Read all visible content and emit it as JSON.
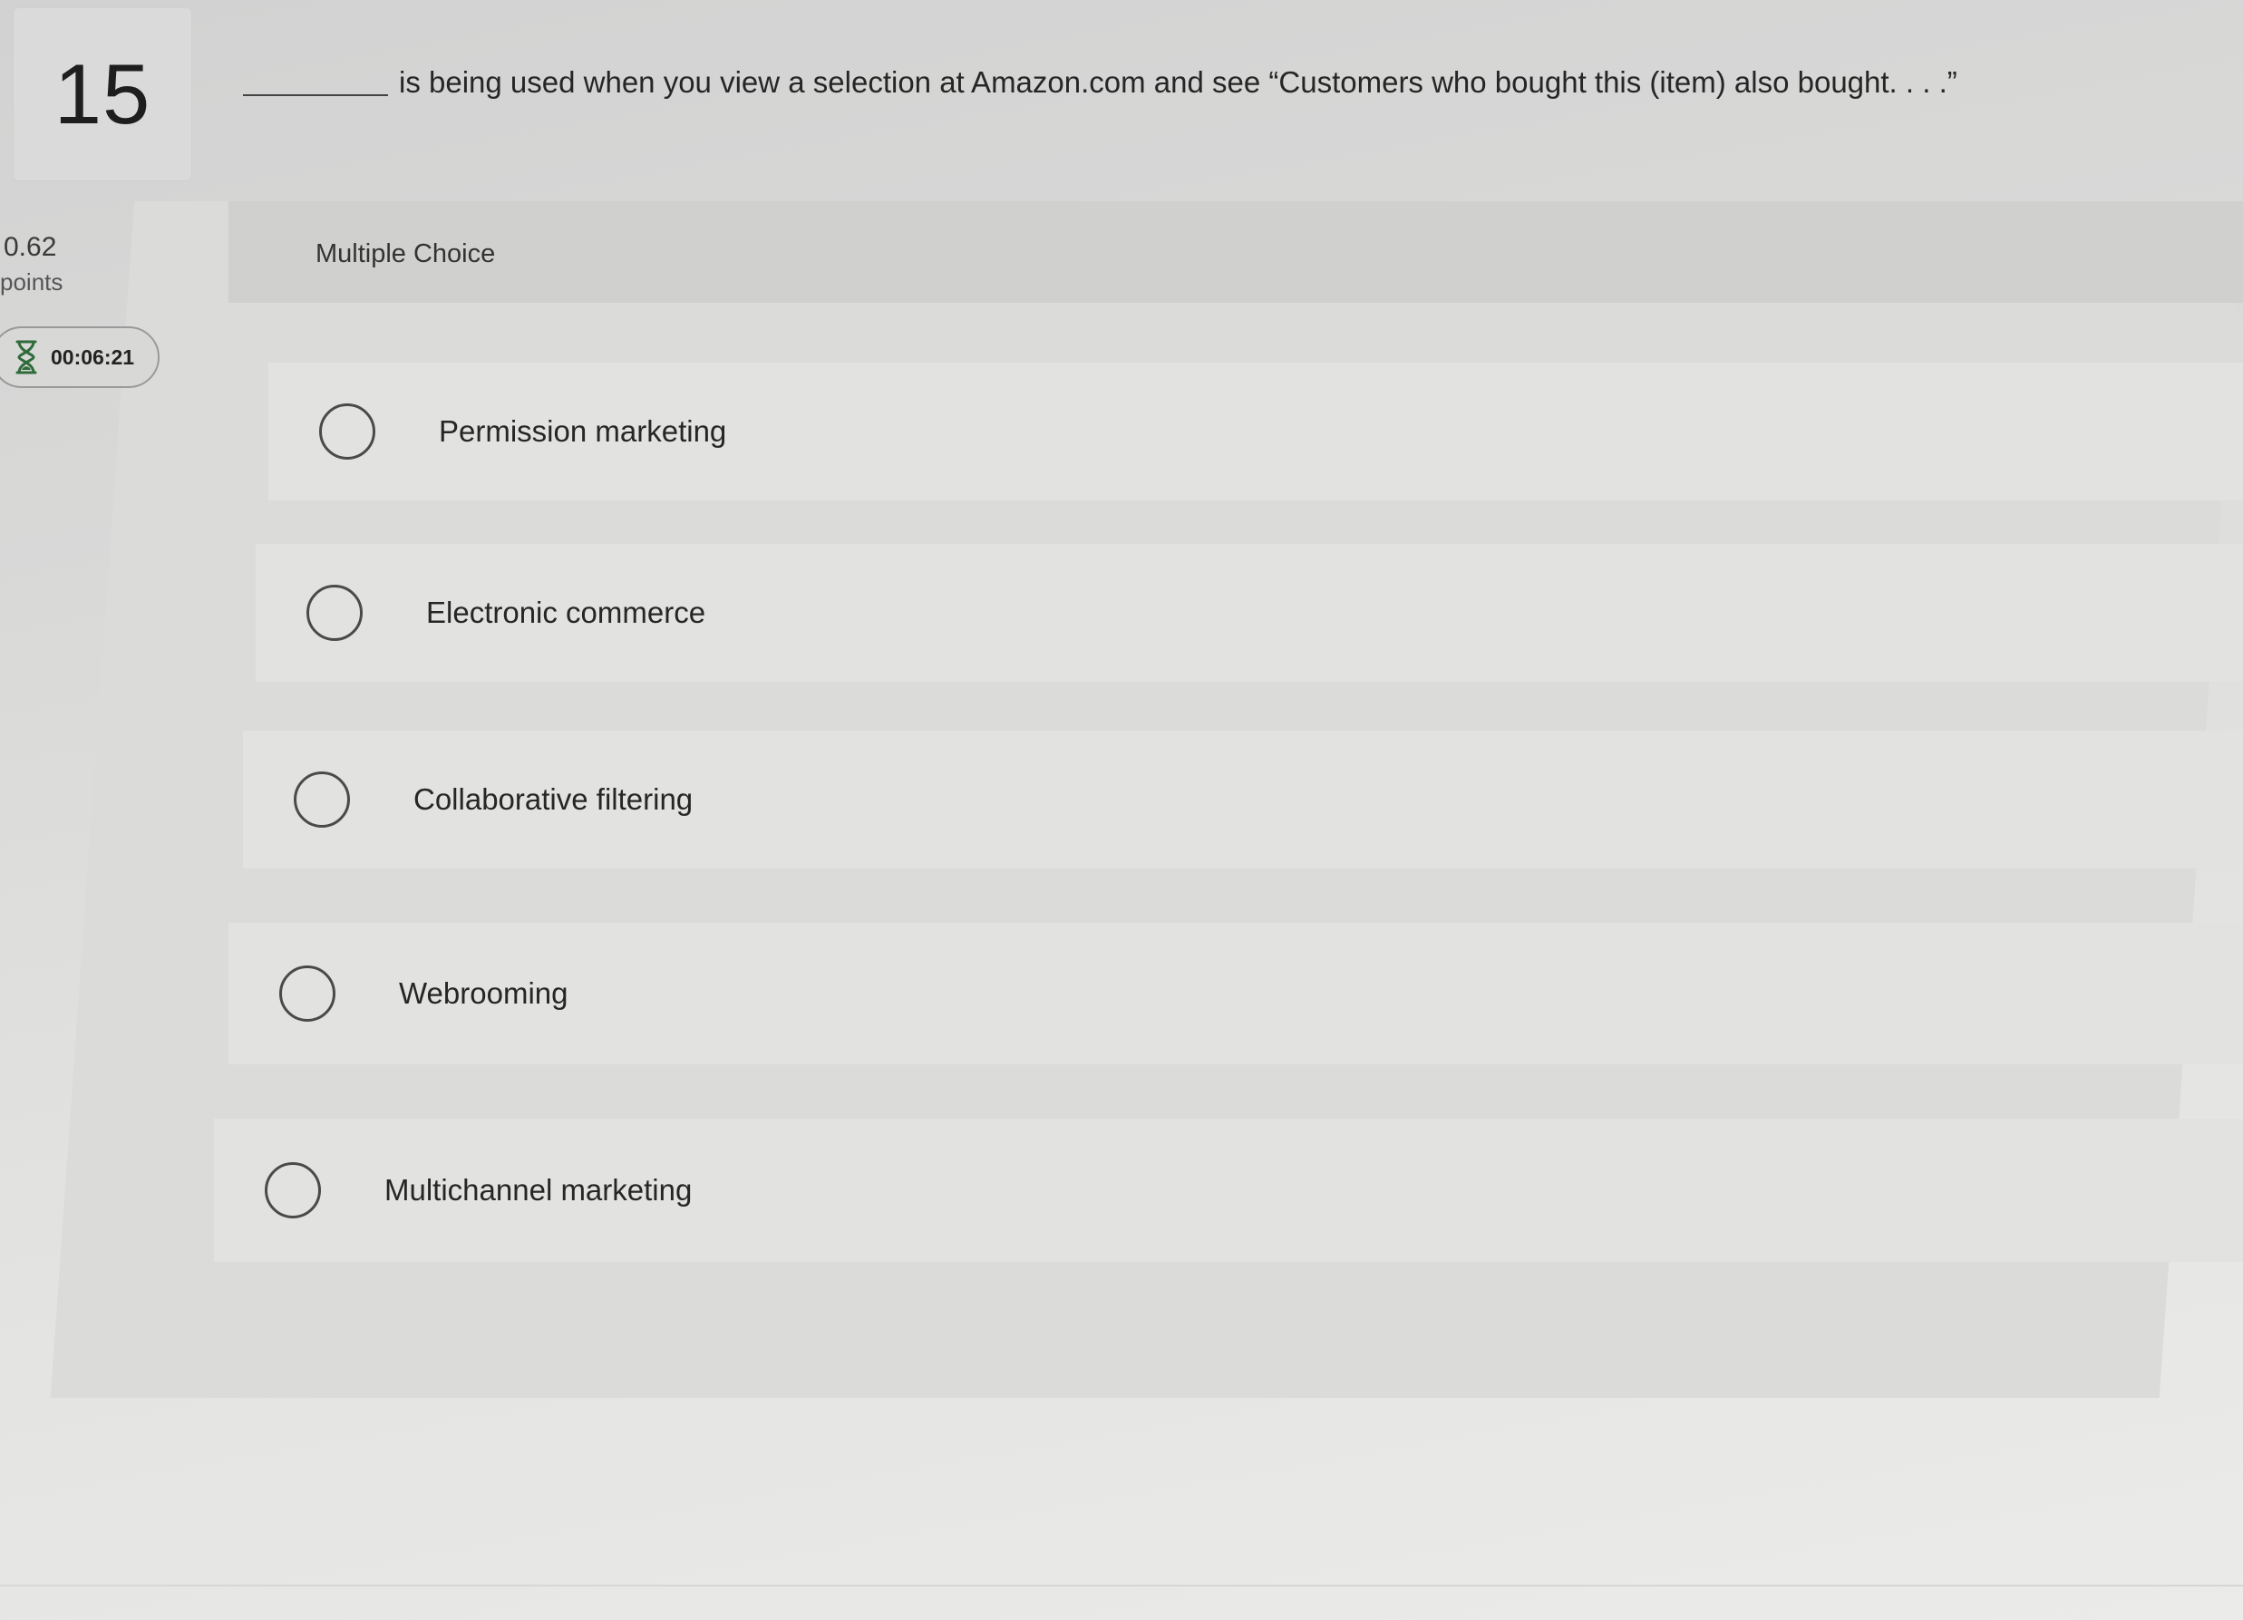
{
  "question": {
    "number": "15",
    "text": "is being used when you view a selection at Amazon.com and see “Customers who bought this (item) also bought. . . .”"
  },
  "score": {
    "value": "0.62",
    "label": "points"
  },
  "timer": {
    "icon": "hourglass-icon",
    "time": "00:06:21"
  },
  "panel": {
    "type_label": "Multiple Choice"
  },
  "options": [
    {
      "label": "Permission marketing"
    },
    {
      "label": "Electronic commerce"
    },
    {
      "label": "Collaborative filtering"
    },
    {
      "label": "Webrooming"
    },
    {
      "label": "Multichannel marketing"
    }
  ]
}
